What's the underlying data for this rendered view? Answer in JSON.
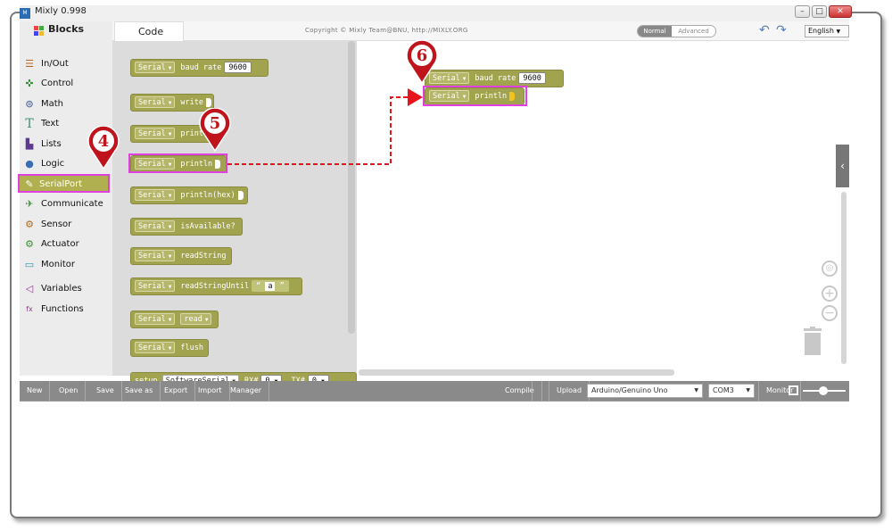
{
  "window": {
    "title": "Mixly 0.998",
    "icon_text": "M"
  },
  "tabs": {
    "blocks": "Blocks",
    "code": "Code"
  },
  "header": {
    "copyright": "Copyright © Mixly Team@BNU, http://MIXLY.ORG",
    "mode_normal": "Normal",
    "mode_advanced": "Advanced",
    "language": "English"
  },
  "sidebar": {
    "items": [
      {
        "label": "In/Out",
        "icon": "inout-icon"
      },
      {
        "label": "Control",
        "icon": "gamepad-icon"
      },
      {
        "label": "Math",
        "icon": "math-icon"
      },
      {
        "label": "Text",
        "icon": "text-icon"
      },
      {
        "label": "Lists",
        "icon": "lists-icon"
      },
      {
        "label": "Logic",
        "icon": "bulb-icon"
      },
      {
        "label": "SerialPort",
        "icon": "serial-icon"
      },
      {
        "label": "Communicate",
        "icon": "satellite-icon"
      },
      {
        "label": "Sensor",
        "icon": "sensor-icon"
      },
      {
        "label": "Actuator",
        "icon": "actuator-icon"
      },
      {
        "label": "Monitor",
        "icon": "monitor-icon"
      },
      {
        "label": "Variables",
        "icon": "variables-icon"
      },
      {
        "label": "Functions",
        "icon": "functions-icon"
      }
    ]
  },
  "flyout": {
    "serial": "Serial",
    "baud_rate": "baud rate",
    "baud_value": "9600",
    "write": "write",
    "print": "print",
    "println": "println",
    "println_hex": "println(hex)",
    "is_available": "isAvailable?",
    "read_string": "readString",
    "read_string_until": "readStringUntil",
    "quote_value": "a",
    "read": "read",
    "flush": "flush",
    "setup": "setup",
    "software_serial": "SoftwareSerial",
    "rx": "RX#",
    "tx": "TX#",
    "rx_value": "0",
    "tx_value": "0"
  },
  "workspace": {
    "serial": "Serial",
    "baud_rate": "baud rate",
    "baud_value": "9600",
    "println": "println"
  },
  "markers": {
    "m4": "4",
    "m5": "5",
    "m6": "6"
  },
  "bottom": {
    "new": "New",
    "open": "Open",
    "save": "Save",
    "save_as": "Save as",
    "export": "Export",
    "import": "Import",
    "manager": "Manager",
    "compile": "Compile",
    "upload": "Upload",
    "board": "Arduino/Genuino Uno",
    "port": "COM3",
    "monitor": "Monitor"
  },
  "colors": {
    "block": "#a2a34f",
    "highlight": "#e040e0",
    "marker": "#c0141c",
    "arrow": "#e8141c"
  }
}
